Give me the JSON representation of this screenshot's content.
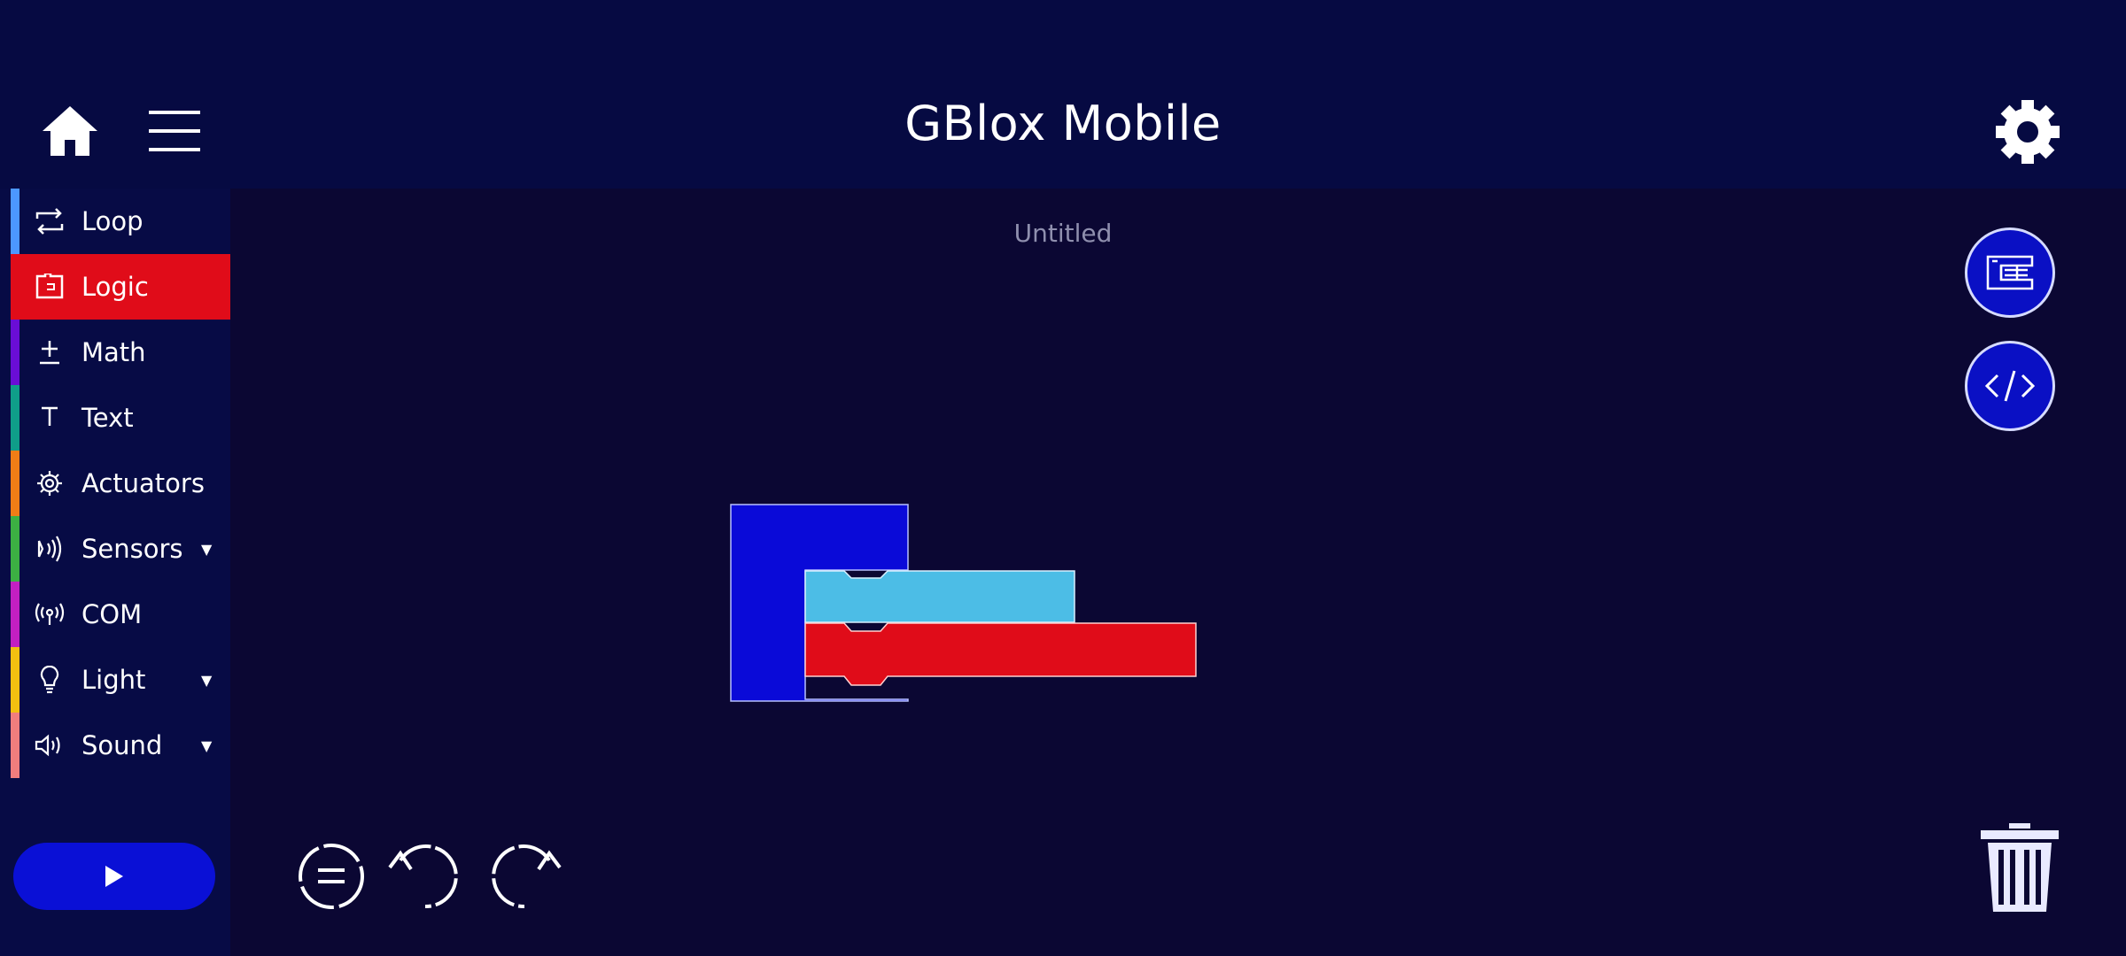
{
  "app": {
    "title": "GBlox Mobile",
    "document_title": "Untitled"
  },
  "colors": {
    "header_bg": "#060a42",
    "workspace_bg": "#0b0733",
    "accent_blue": "#0a10d6",
    "logic_red": "#e00c19"
  },
  "header": {
    "home_icon": "home-icon",
    "menu_icon": "hamburger-menu-icon",
    "settings_icon": "gear-icon"
  },
  "sidebar": {
    "categories": [
      {
        "label": "Loop",
        "icon": "loop-icon",
        "color": "#4c97ff",
        "active": false,
        "expandable": false
      },
      {
        "label": "Logic",
        "icon": "logic-icon",
        "color": "#e00c19",
        "active": true,
        "expandable": false
      },
      {
        "label": "Math",
        "icon": "plus-minus-icon",
        "color": "#6a0dd6",
        "active": false,
        "expandable": false
      },
      {
        "label": "Text",
        "icon": "text-icon",
        "color": "#0f9d89",
        "active": false,
        "expandable": false
      },
      {
        "label": "Actuators",
        "icon": "gear-icon",
        "color": "#f07d16",
        "active": false,
        "expandable": false
      },
      {
        "label": "Sensors",
        "icon": "sensor-icon",
        "color": "#3cb043",
        "active": false,
        "expandable": true
      },
      {
        "label": "COM",
        "icon": "antenna-icon",
        "color": "#c21fc2",
        "active": false,
        "expandable": false
      },
      {
        "label": "Light",
        "icon": "lightbulb-icon",
        "color": "#f2c010",
        "active": false,
        "expandable": true
      },
      {
        "label": "Sound",
        "icon": "speaker-icon",
        "color": "#f07d7d",
        "active": false,
        "expandable": true
      }
    ],
    "play_icon": "play-icon"
  },
  "toolbar": {
    "blocks_view_icon": "blocks-view-icon",
    "code_view_icon": "code-icon",
    "zoom_reset_icon": "zoom-reset-icon",
    "undo_icon": "undo-icon",
    "redo_icon": "redo-icon",
    "trash_icon": "trash-icon"
  },
  "workspace_blocks": [
    {
      "type": "container",
      "color": "#0a0ad8"
    },
    {
      "type": "condition",
      "color": "#4cbde6"
    },
    {
      "type": "statement",
      "color": "#e00c19"
    }
  ]
}
